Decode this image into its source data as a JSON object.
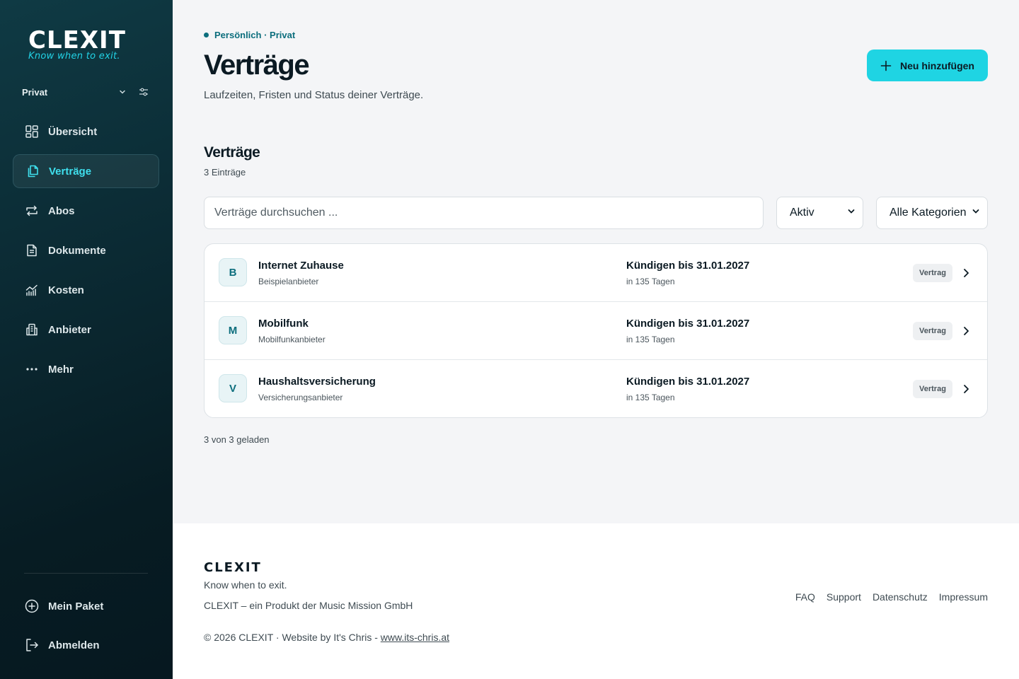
{
  "brand": {
    "name": "CLEXIT",
    "tagline": "Know when to exit."
  },
  "sidebar": {
    "workspace": "Privat",
    "items": [
      {
        "label": "Übersicht",
        "icon": "grid-icon",
        "active": false
      },
      {
        "label": "Verträge",
        "icon": "documents-icon",
        "active": true
      },
      {
        "label": "Abos",
        "icon": "repeat-icon",
        "active": false
      },
      {
        "label": "Dokumente",
        "icon": "file-text-icon",
        "active": false
      },
      {
        "label": "Kosten",
        "icon": "chart-icon",
        "active": false
      },
      {
        "label": "Anbieter",
        "icon": "building-icon",
        "active": false
      },
      {
        "label": "Mehr",
        "icon": "more-icon",
        "active": false
      }
    ],
    "bottom_items": [
      {
        "label": "Mein Paket",
        "icon": "plus-circle-icon"
      },
      {
        "label": "Abmelden",
        "icon": "logout-icon"
      }
    ]
  },
  "header": {
    "breadcrumb": "Persönlich · Privat",
    "title": "Verträge",
    "subtitle": "Laufzeiten, Fristen und Status deiner Verträge.",
    "add_button": "Neu hinzufügen"
  },
  "section": {
    "title": "Verträge",
    "count": "3 Einträge"
  },
  "filters": {
    "search_placeholder": "Verträge durchsuchen ...",
    "status": "Aktiv",
    "category": "Alle Kategorien"
  },
  "contracts": [
    {
      "initial": "B",
      "name": "Internet Zuhause",
      "provider": "Beispielanbieter",
      "deadline": "Kündigen bis 31.01.2027",
      "days": "in 135 Tagen",
      "badge": "Vertrag"
    },
    {
      "initial": "M",
      "name": "Mobilfunk",
      "provider": "Mobilfunkanbieter",
      "deadline": "Kündigen bis 31.01.2027",
      "days": "in 135 Tagen",
      "badge": "Vertrag"
    },
    {
      "initial": "V",
      "name": "Haushaltsversicherung",
      "provider": "Versicherungsanbieter",
      "deadline": "Kündigen bis 31.01.2027",
      "days": "in 135 Tagen",
      "badge": "Vertrag"
    }
  ],
  "loaded_text": "3 von 3 geladen",
  "footer": {
    "brand": "CLEXIT",
    "tagline": "Know when to exit.",
    "company": "CLEXIT – ein Produkt der Music Mission GmbH",
    "copyright": "© 2026 CLEXIT · Website by It's Chris - ",
    "website": "www.its-chris.at",
    "links": [
      "FAQ",
      "Support",
      "Datenschutz",
      "Impressum"
    ]
  },
  "colors": {
    "accent": "#1fd4e3",
    "active_nav": "#3fe0ee",
    "brand_teal": "#0c6e7d",
    "sidebar_bg": "#0b2a33"
  }
}
